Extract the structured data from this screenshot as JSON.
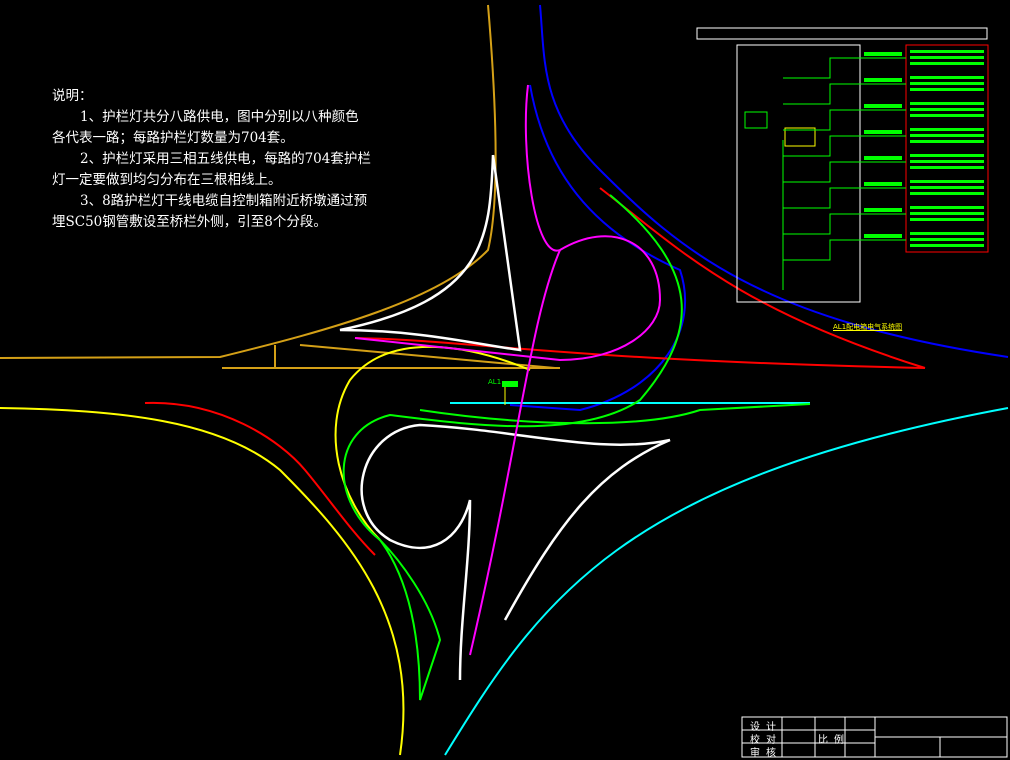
{
  "notes": {
    "heading": "说明：",
    "line1a": "1、护栏灯共分八路供电，图中分别以八种颜色",
    "line1b": "各代表一路；每路护栏灯数量为704套。",
    "line2a": "2、护栏灯采用三相五线供电，每路的704套护栏",
    "line2b": "灯一定要做到均匀分布在三根相线上。",
    "line3a": "3、8路护栏灯干线电缆自控制箱附近桥墩通过预",
    "line3b": "埋SC50钢管敷设至桥栏外侧，引至8个分段。"
  },
  "schematic": {
    "caption": "AL1配电箱电气系统图"
  },
  "controlbox_label": "AL1",
  "title_block": {
    "design": "设 计",
    "check": "校 对",
    "review": "审 核",
    "scale_label": "比 例"
  },
  "colors": {
    "yellow": "#ffff00",
    "orange": "#d4a017",
    "blue": "#0000ff",
    "red": "#ff0000",
    "white": "#ffffff",
    "magenta": "#ff00ff",
    "green": "#00ff00",
    "cyan": "#00ffff"
  }
}
